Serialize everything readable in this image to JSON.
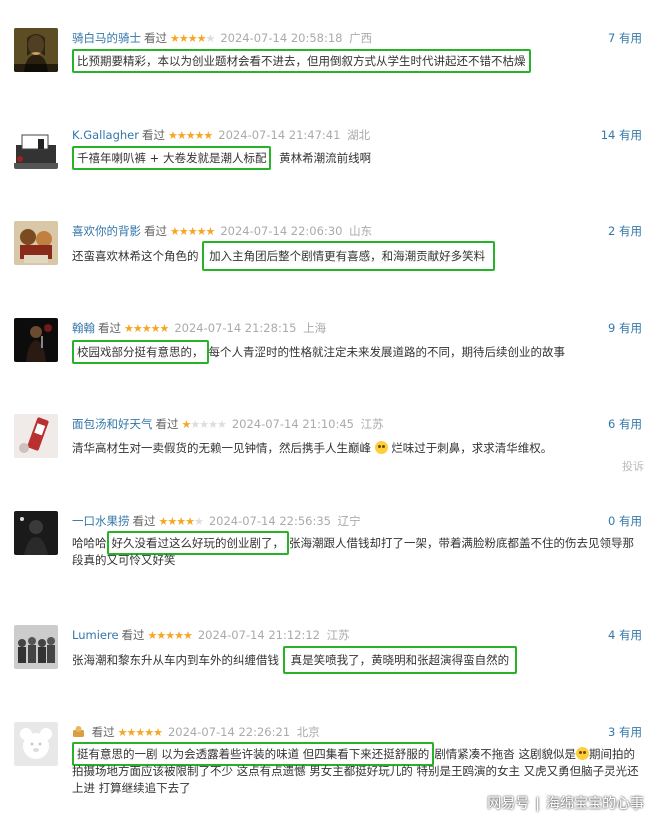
{
  "comments": [
    {
      "user": "骑白马的骑士",
      "watched": "看过",
      "rating": 4,
      "time": "2024-07-14 20:58:18",
      "location": "广西",
      "useful": "7 有用",
      "text": "比预期要精彩，本以为创业题材会看不进去，但用倒叙方式从学生时代讲起还不错不枯燥",
      "avatar": "mona-lisa-avatar"
    },
    {
      "user": "K.Gallagher",
      "watched": "看过",
      "rating": 5,
      "time": "2024-07-14 21:47:41",
      "location": "湖北",
      "useful": "14 有用",
      "text_hl": "千禧年喇叭裤 + 大卷发就是潮人标配",
      "text_rest": "黄林希潮流前线啊",
      "avatar": "house-avatar"
    },
    {
      "user": "喜欢你的背影",
      "watched": "看过",
      "rating": 5,
      "time": "2024-07-14 22:06:30",
      "location": "山东",
      "useful": "2 有用",
      "text_pre": "还蛮喜欢林希这个角色的",
      "text_hl": "加入主角团后整个剧情更有喜感，和海潮贡献好多笑料",
      "avatar": "cartoon-avatar"
    },
    {
      "user": "翰翰",
      "watched": "看过",
      "rating": 5,
      "time": "2024-07-14 21:28:15",
      "location": "上海",
      "useful": "9 有用",
      "text_hl": "校园戏部分挺有意思的，",
      "text_rest": "每个人青涩时的性格就注定未来发展道路的不同，期待后续创业的故事",
      "avatar": "stage-avatar"
    },
    {
      "user": "面包汤和好天气",
      "watched": "看过",
      "rating": 1,
      "time": "2024-07-14 21:10:45",
      "location": "江苏",
      "useful": "6 有用",
      "text_pre": "清华高材生对一卖假货的无赖一见钟情，然后携手人生巅峰",
      "text_rest": "烂味过于刺鼻，求求清华维权。",
      "report": "投诉",
      "avatar": "product-avatar"
    },
    {
      "user": "一口水果捞",
      "watched": "看过",
      "rating": 4,
      "time": "2024-07-14 22:56:35",
      "location": "辽宁",
      "useful": "0 有用",
      "text_pre": "哈哈哈",
      "text_hl": "好久没看过这么好玩的创业剧了，",
      "text_rest": "张海潮跟人借钱却打了一架，带着满脸粉底都盖不住的伤去见领导那段真的又可怜又好笑",
      "avatar": "night-avatar"
    },
    {
      "user": "Lumiere",
      "watched": "看过",
      "rating": 5,
      "time": "2024-07-14 21:12:12",
      "location": "江苏",
      "useful": "4 有用",
      "text_pre": "张海潮和黎东升从车内到车外的纠缠借钱",
      "text_hl": "真是笑喷我了，黄晓明和张超演得蛮自然的",
      "avatar": "group-avatar"
    },
    {
      "user": "",
      "watched": "看过",
      "rating": 5,
      "time": "2024-07-14 22:26:21",
      "location": "北京",
      "useful": "3 有用",
      "text_hl": "挺有意思的一剧 以为会透露着些许装的味道 但四集看下来还挺舒服的",
      "text_rest": "剧情紧凑不拖沓 这剧貌似是",
      "text_rest2": "期间拍的 拍摄场地方面应该被限制了不少 这点有点遗憾 男女主都挺好玩儿的 特别是王鸥演的女主 又虎又勇但脑子灵光还上进 打算继续追下去了",
      "avatar": "default-bear-avatar"
    }
  ],
  "watermark": {
    "brand": "网易号",
    "sep": "|",
    "author": "海绵宝宝的心事"
  },
  "colors": {
    "link": "#3377aa",
    "star": "#f5a623",
    "highlight": "#27b327"
  }
}
